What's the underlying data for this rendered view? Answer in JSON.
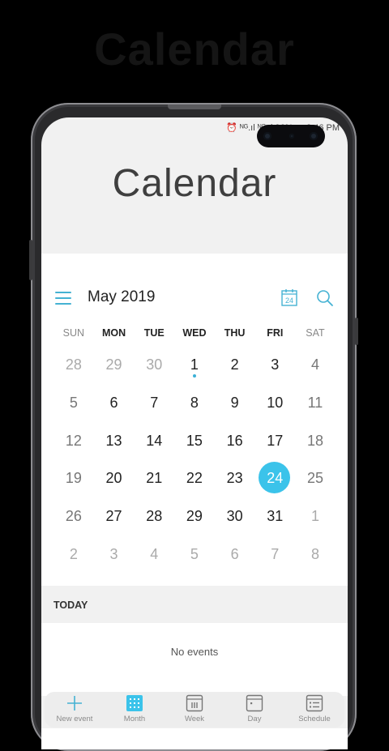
{
  "background_title": "Calendar",
  "status_bar": {
    "text": "⏰ ᴺᴳ.ıl ᴺᴳ.ıl 96% ▭ 2:46 PM"
  },
  "app": {
    "title": "Calendar",
    "accent": "#3bc3ea"
  },
  "header": {
    "month_label": "May 2019",
    "today_icon_day": "24"
  },
  "weekdays": [
    "SUN",
    "MON",
    "TUE",
    "WED",
    "THU",
    "FRI",
    "SAT"
  ],
  "weeks": [
    [
      {
        "d": "28",
        "o": true
      },
      {
        "d": "29",
        "o": true
      },
      {
        "d": "30",
        "o": true
      },
      {
        "d": "1",
        "dot": true
      },
      {
        "d": "2"
      },
      {
        "d": "3"
      },
      {
        "d": "4",
        "w": true
      }
    ],
    [
      {
        "d": "5",
        "w": true
      },
      {
        "d": "6"
      },
      {
        "d": "7"
      },
      {
        "d": "8"
      },
      {
        "d": "9"
      },
      {
        "d": "10"
      },
      {
        "d": "11",
        "w": true
      }
    ],
    [
      {
        "d": "12",
        "w": true
      },
      {
        "d": "13"
      },
      {
        "d": "14"
      },
      {
        "d": "15"
      },
      {
        "d": "16"
      },
      {
        "d": "17"
      },
      {
        "d": "18",
        "w": true
      }
    ],
    [
      {
        "d": "19",
        "w": true
      },
      {
        "d": "20"
      },
      {
        "d": "21"
      },
      {
        "d": "22"
      },
      {
        "d": "23"
      },
      {
        "d": "24",
        "sel": true
      },
      {
        "d": "25",
        "w": true
      }
    ],
    [
      {
        "d": "26",
        "w": true
      },
      {
        "d": "27"
      },
      {
        "d": "28"
      },
      {
        "d": "29"
      },
      {
        "d": "30"
      },
      {
        "d": "31"
      },
      {
        "d": "1",
        "o": true
      }
    ],
    [
      {
        "d": "2",
        "o": true
      },
      {
        "d": "3",
        "o": true
      },
      {
        "d": "4",
        "o": true
      },
      {
        "d": "5",
        "o": true
      },
      {
        "d": "6",
        "o": true
      },
      {
        "d": "7",
        "o": true
      },
      {
        "d": "8",
        "o": true
      }
    ]
  ],
  "today_section": {
    "label": "TODAY",
    "empty_text": "No events"
  },
  "bottom_nav": [
    {
      "label": "New event",
      "icon": "plus-icon"
    },
    {
      "label": "Month",
      "icon": "month-grid-icon"
    },
    {
      "label": "Week",
      "icon": "week-view-icon"
    },
    {
      "label": "Day",
      "icon": "day-view-icon"
    },
    {
      "label": "Schedule",
      "icon": "schedule-list-icon"
    }
  ]
}
